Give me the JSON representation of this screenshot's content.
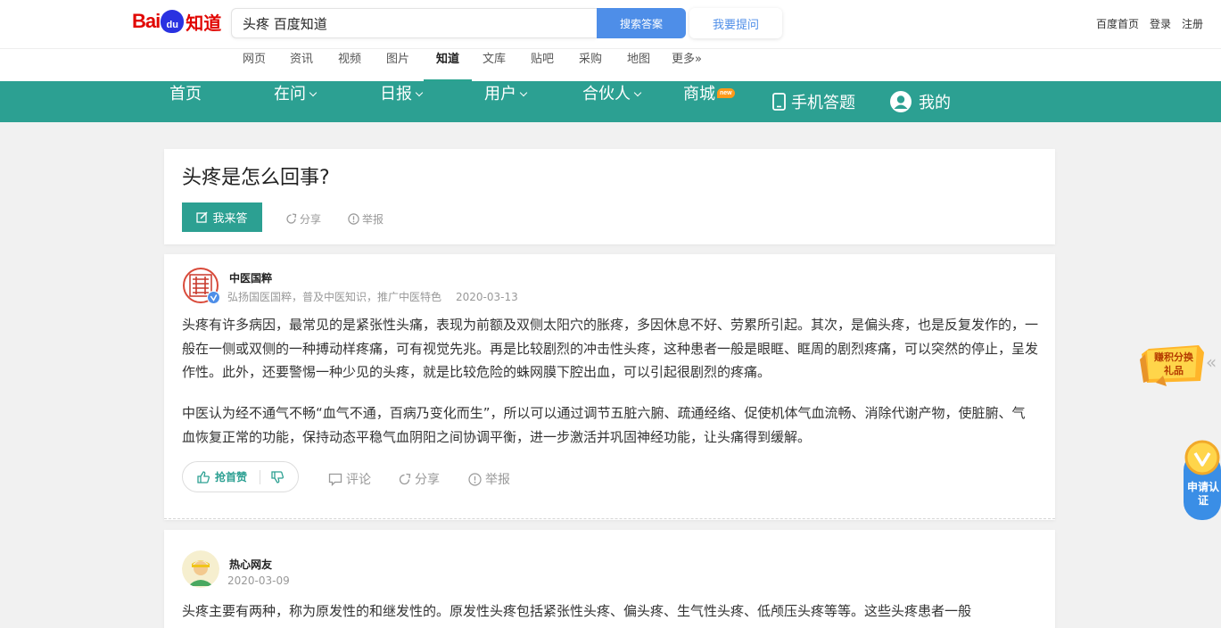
{
  "header": {
    "logo": {
      "bai": "Bai",
      "du": "du",
      "zhidao": "知道"
    },
    "search": {
      "value": "头疼 百度知道",
      "button": "搜索答案"
    },
    "ask_button": "我要提问",
    "links": [
      "百度首页",
      "登录",
      "注册"
    ]
  },
  "subnav": {
    "items": [
      "网页",
      "资讯",
      "视频",
      "图片",
      "知道",
      "文库",
      "贴吧",
      "采购",
      "地图",
      "更多»"
    ],
    "active": "知道"
  },
  "mainnav": {
    "items": [
      {
        "label": "首页"
      },
      {
        "label": "在问"
      },
      {
        "label": "日报"
      },
      {
        "label": "用户"
      },
      {
        "label": "合伙人"
      },
      {
        "label": "商城",
        "badge": "new"
      },
      {
        "label": "手机答题"
      },
      {
        "label": "我的"
      }
    ],
    "bg_color": "#2ca092"
  },
  "question": {
    "title": "头疼是怎么回事?",
    "answer_button": "我来答",
    "share": "分享",
    "report": "举报"
  },
  "answers": [
    {
      "author": "中医国粹",
      "bio": "弘扬国医国粹，普及中医知识，推广中医特色",
      "date": "2020-03-13",
      "paragraphs": [
        "头疼有许多病因，最常见的是紧张性头痛，表现为前额及双侧太阳穴的胀疼，多因休息不好、劳累所引起。其次，是偏头疼，也是反复发作的，一般在一侧或双侧的一种搏动样疼痛，可有视觉先兆。再是比较剧烈的冲击性头疼，这种患者一般是眼眶、眶周的剧烈疼痛，可以突然的停止，呈发作性。此外，还要警惕一种少见的头疼，就是比较危险的蛛网膜下腔出血，可以引起很剧烈的疼痛。",
        "中医认为经不通气不畅“血气不通，百病乃变化而生”，所以可以通过调节五脏六腑、疏通经络、促使机体气血流畅、消除代谢产物，使脏腑、气血恢复正常的功能，保持动态平稳气血阴阳之间协调平衡，进一步激活并巩固神经功能，让头痛得到缓解。"
      ],
      "like_label": "抢首赞",
      "comment": "评论",
      "share": "分享",
      "report": "举报"
    },
    {
      "author": "热心网友",
      "date": "2020-03-09",
      "paragraphs": [
        "头疼主要有两种，称为原发性的和继发性的。原发性头疼包括紧张性头疼、偏头疼、生气性头疼、低颅压头疼等等。这些头疼患者一般"
      ]
    }
  ],
  "sidebar": {
    "gift": "赚积分换礼品",
    "cert": "申请认证",
    "collapse": "«"
  }
}
